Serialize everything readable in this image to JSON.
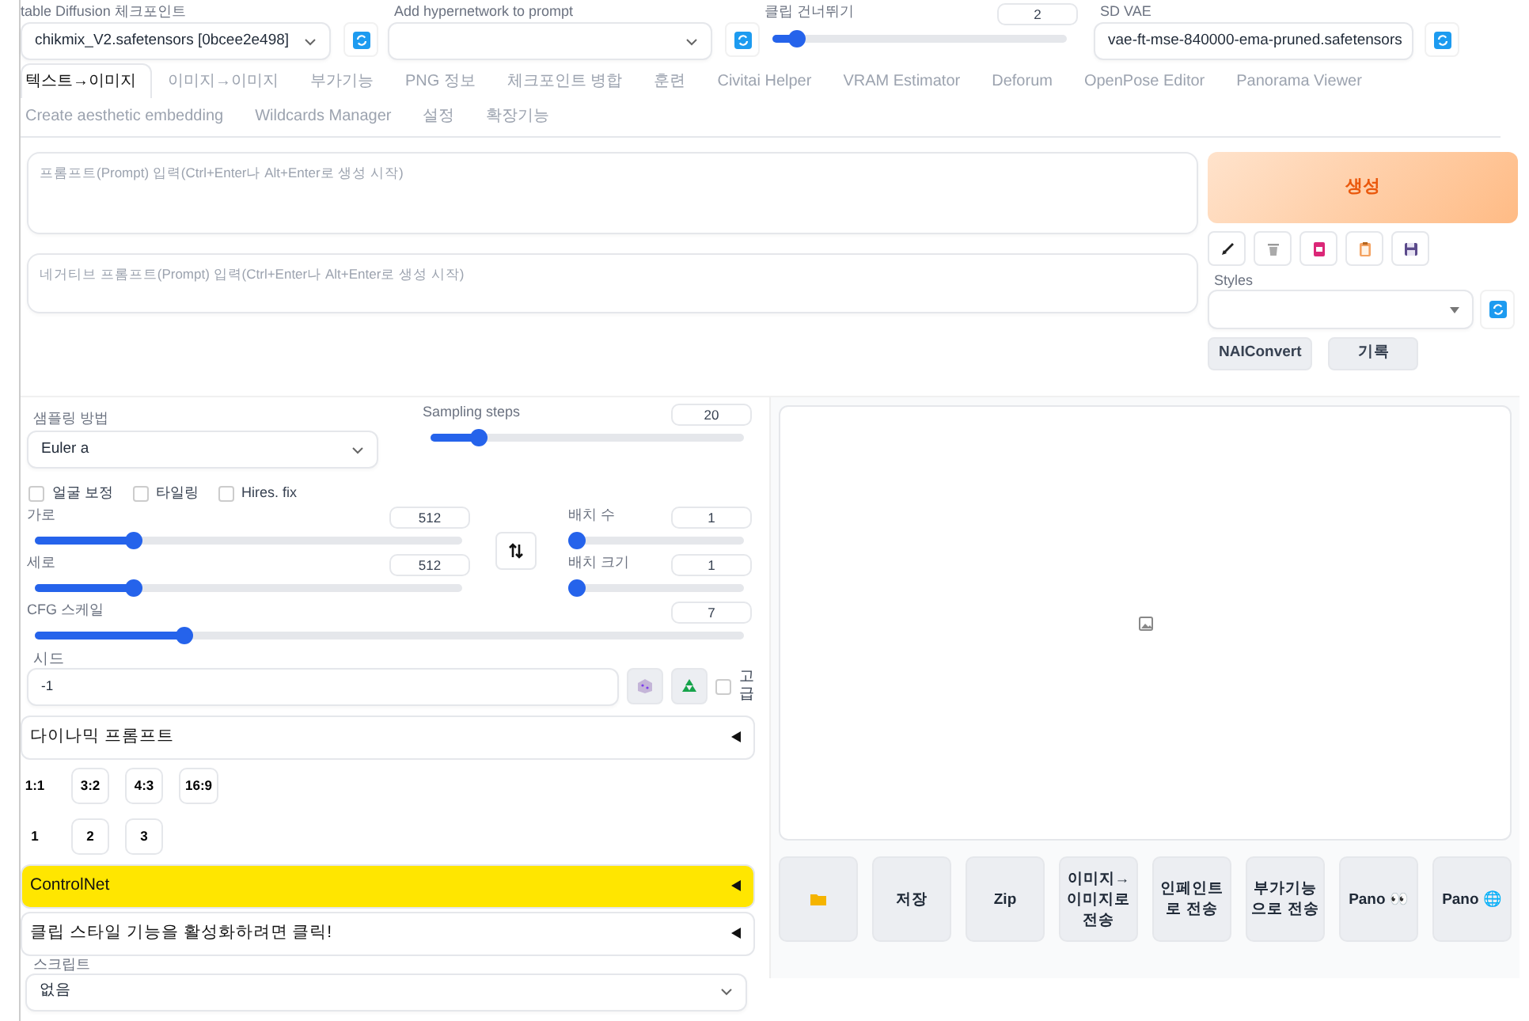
{
  "top_bar": {
    "checkpoint": {
      "label": "table Diffusion 체크포인트",
      "value": "chikmix_V2.safetensors [0bcee2e498]"
    },
    "hypernetwork": {
      "label": "Add hypernetwork to prompt"
    },
    "clip_skip": {
      "label": "클립 건너뛰기",
      "value": "2",
      "level": 0.08
    },
    "vae": {
      "label": "SD VAE",
      "value": "vae-ft-mse-840000-ema-pruned.safetensors"
    }
  },
  "tabs": [
    {
      "label": "텍스트→이미지",
      "selected": true
    },
    {
      "label": "이미지→이미지",
      "selected": false
    },
    {
      "label": "부가기능",
      "selected": false
    },
    {
      "label": "PNG 정보",
      "selected": false
    },
    {
      "label": "체크포인트 병합",
      "selected": false
    },
    {
      "label": "훈련",
      "selected": false
    },
    {
      "label": "Civitai Helper",
      "selected": false
    },
    {
      "label": "VRAM Estimator",
      "selected": false
    },
    {
      "label": "Deforum",
      "selected": false
    },
    {
      "label": "OpenPose Editor",
      "selected": false
    },
    {
      "label": "Panorama Viewer",
      "selected": false
    },
    {
      "label": "Create aesthetic embedding",
      "selected": false
    },
    {
      "label": "Wildcards Manager",
      "selected": false
    },
    {
      "label": "설정",
      "selected": false
    },
    {
      "label": "확장기능",
      "selected": false
    }
  ],
  "prompt": {
    "placeholder": "프롬프트(Prompt) 입력(Ctrl+Enter나 Alt+Enter로 생성 시작)"
  },
  "negative_prompt": {
    "placeholder": "네거티브 프롬프트(Prompt) 입력(Ctrl+Enter나 Alt+Enter로 생성 시작)"
  },
  "generate": {
    "label": "생성"
  },
  "tool_buttons": [
    {
      "kind": "arrow"
    },
    {
      "kind": "trash"
    },
    {
      "kind": "book"
    },
    {
      "kind": "clipboard"
    },
    {
      "kind": "save"
    }
  ],
  "styles": {
    "label": "Styles"
  },
  "extra_buttons": [
    {
      "label": "NAIConvert"
    },
    {
      "label": "기록"
    }
  ],
  "sampling_method": {
    "label": "샘플링 방법",
    "value": "Euler a"
  },
  "sampling_steps": {
    "label": "Sampling steps",
    "value": "20",
    "level": 0.15
  },
  "checkboxes": [
    {
      "label": "얼굴 보정",
      "checked": false
    },
    {
      "label": "타일링",
      "checked": false
    },
    {
      "label": "Hires. fix",
      "checked": false
    }
  ],
  "width": {
    "label": "가로",
    "value": "512",
    "level": 0.23
  },
  "height": {
    "label": "세로",
    "value": "512",
    "level": 0.23
  },
  "batch_count": {
    "label": "배치 수",
    "value": "1",
    "level": 0
  },
  "batch_size": {
    "label": "배치 크기",
    "value": "1",
    "level": 0
  },
  "cfg_scale": {
    "label": "CFG 스케일",
    "value": "7",
    "level": 0.21
  },
  "seed": {
    "label": "시드",
    "value": "-1"
  },
  "seed_extra": {
    "label": "고급",
    "checked": false
  },
  "dynamic_prompts": {
    "label": "다이나믹 프롬프트",
    "expanded": false
  },
  "aspect_buttons": [
    "1:1",
    "3:2",
    "4:3",
    "16:9"
  ],
  "count_buttons": [
    "1",
    "2",
    "3"
  ],
  "accordions": [
    {
      "label": "ControlNet",
      "expanded": false,
      "highlighted": true
    },
    {
      "label": "클립 스타일 기능을 활성화하려면 클릭!",
      "expanded": false,
      "highlighted": false
    }
  ],
  "script": {
    "label": "스크립트",
    "value": "없음"
  },
  "gallery_buttons": [
    {
      "kind": "folder"
    },
    {
      "kind": "text",
      "label": "저장"
    },
    {
      "kind": "text",
      "label": "Zip"
    },
    {
      "kind": "text",
      "label": "이미지→이미지로 전송"
    },
    {
      "kind": "text",
      "label": "인페인트로 전송"
    },
    {
      "kind": "text",
      "label": "부가기능으로 전송"
    },
    {
      "kind": "text",
      "label": "Pano 👀"
    },
    {
      "kind": "text",
      "label": "Pano 🌐"
    }
  ]
}
